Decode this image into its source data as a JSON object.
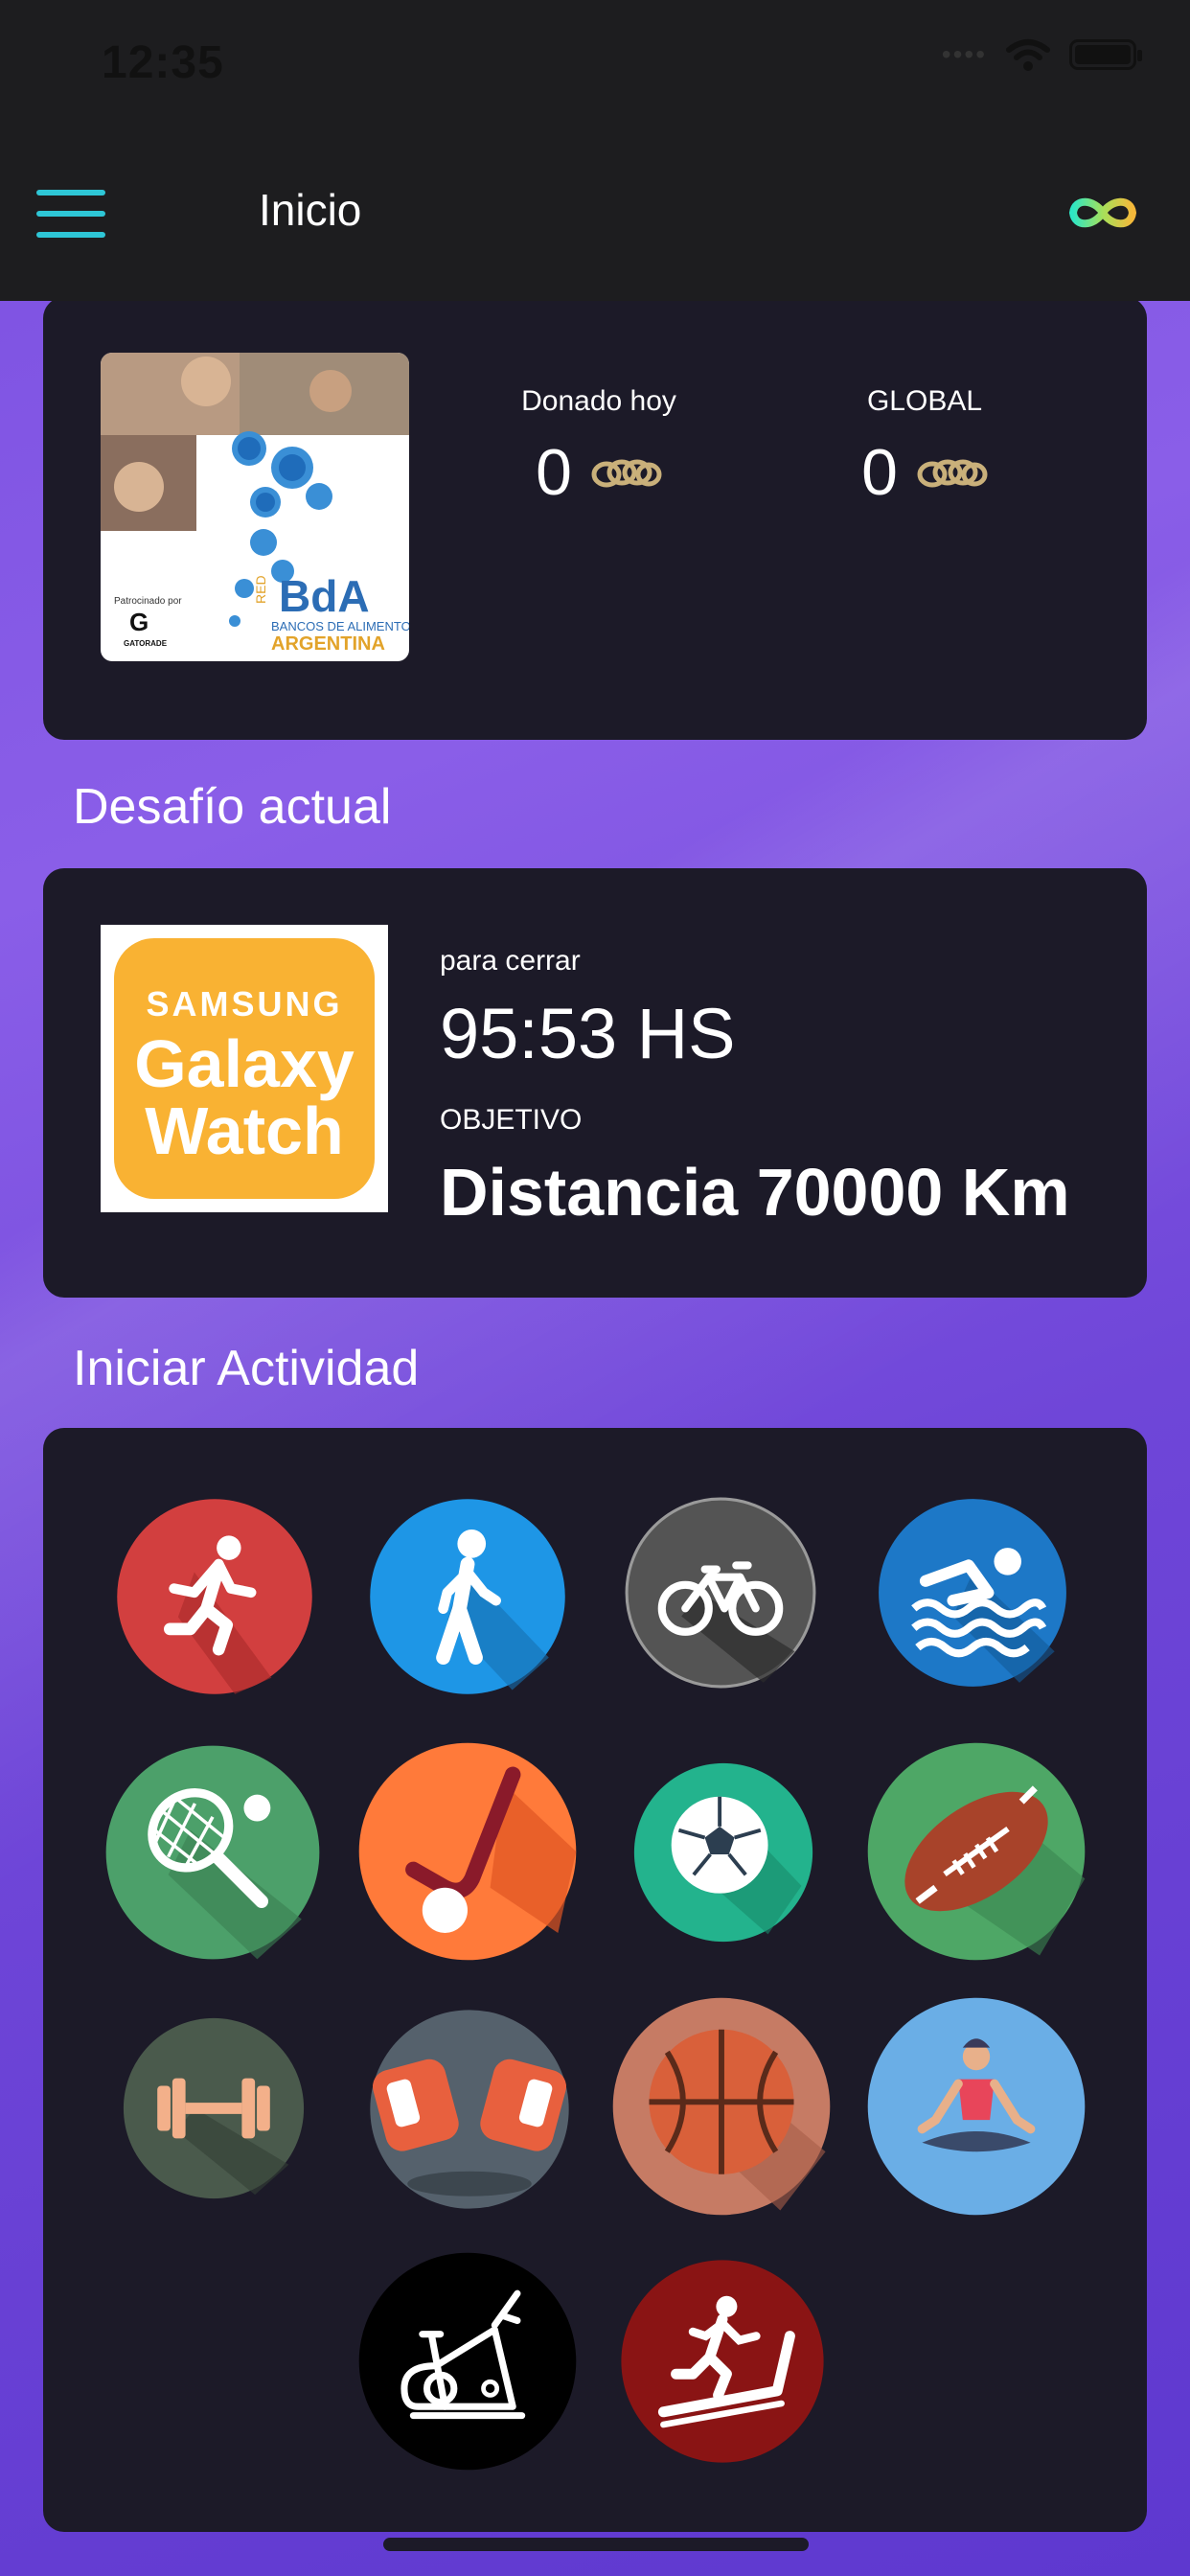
{
  "status_bar": {
    "time": "12:35"
  },
  "header": {
    "title": "Inicio",
    "menu_icon": "hamburger-icon",
    "logo_icon": "infinity-logo-icon",
    "accent": "#2ec6d6"
  },
  "donation": {
    "sponsor_image": "red-bda-bancos-de-alimentos-argentina-logo",
    "sponsor_logo_text": {
      "top": "RED",
      "brand": "BdA",
      "line1": "BANCOS DE ALIMENTOS",
      "line2": "ARGENTINA",
      "sponsored_by": "Patrocinado por",
      "sponsor": "GATORADE"
    },
    "today": {
      "label": "Donado hoy",
      "value": "0"
    },
    "global": {
      "label": "GLOBAL",
      "value": "0"
    },
    "unit_icon": "coin-chain-icon"
  },
  "challenge": {
    "section_title": "Desafío actual",
    "prize_image": {
      "line1": "SAMSUNG",
      "line2": "Galaxy",
      "line3": "Watch"
    },
    "close_label": "para cerrar",
    "time_left": "95:53 HS",
    "objective_label": "OBJETIVO",
    "objective": "Distancia 70000 Km"
  },
  "activities": {
    "section_title": "Iniciar Actividad",
    "items": [
      {
        "name": "running",
        "icon": "running-icon",
        "color": "#d23f3f"
      },
      {
        "name": "walking",
        "icon": "walking-icon",
        "color": "#1e96e6"
      },
      {
        "name": "cycling",
        "icon": "bicycle-icon",
        "color": "#545454"
      },
      {
        "name": "swimming",
        "icon": "swimming-icon",
        "color": "#1d78c7"
      },
      {
        "name": "tennis",
        "icon": "tennis-icon",
        "color": "#4ca06a"
      },
      {
        "name": "hockey",
        "icon": "hockey-icon",
        "color": "#ff7a3a"
      },
      {
        "name": "soccer",
        "icon": "soccer-ball-icon",
        "color": "#23b38d"
      },
      {
        "name": "rugby",
        "icon": "rugby-ball-icon",
        "color": "#4ea766"
      },
      {
        "name": "weights",
        "icon": "dumbbell-icon",
        "color": "#4a5a4c"
      },
      {
        "name": "boxing",
        "icon": "boxing-gloves-icon",
        "color": "#55616c"
      },
      {
        "name": "basketball",
        "icon": "basketball-icon",
        "color": "#c67b64"
      },
      {
        "name": "yoga",
        "icon": "yoga-icon",
        "color": "#6aaee6"
      },
      {
        "name": "stationary-bike",
        "icon": "stationary-bike-icon",
        "color": "#000000"
      },
      {
        "name": "treadmill",
        "icon": "treadmill-icon",
        "color": "#8a1414"
      }
    ]
  }
}
